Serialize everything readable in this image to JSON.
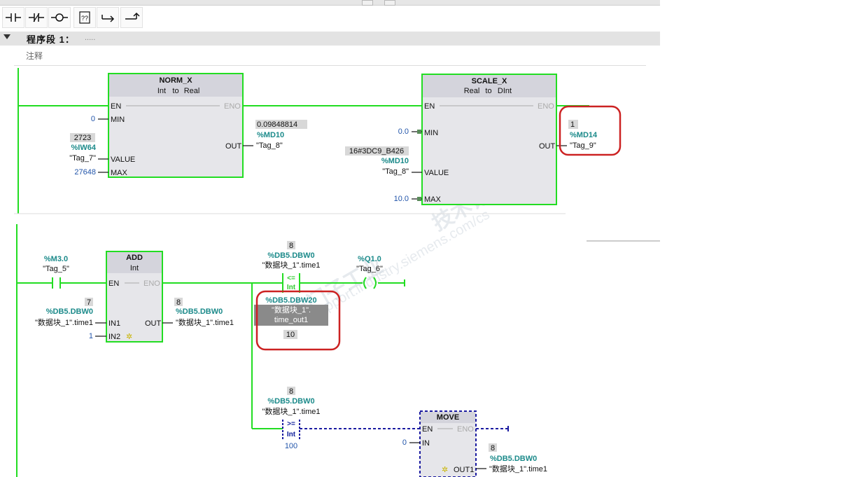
{
  "toolbar": {
    "buttons": [
      {
        "name": "no-contact-icon"
      },
      {
        "name": "nc-contact-icon"
      },
      {
        "name": "coil-icon"
      },
      {
        "name": "empty-box-icon"
      },
      {
        "name": "open-branch-icon"
      },
      {
        "name": "close-branch-icon"
      }
    ]
  },
  "segment": {
    "title": "程序段 1：",
    "dots": ".....",
    "comment": "注释"
  },
  "colors": {
    "power": "#22dd22",
    "blue_wire": "#1a1aa0",
    "highlight": "#cc2222",
    "tag": "#1b8a8a",
    "block_fill": "#e6e6ea"
  },
  "norm": {
    "name": "NORM_X",
    "type1": "Int",
    "to": "to",
    "type2": "Real",
    "en": "EN",
    "eno": "ENO",
    "min": "MIN",
    "value": "VALUE",
    "max": "MAX",
    "out": "OUT",
    "min_val": "0",
    "value_live": "2723",
    "value_addr": "%IW64",
    "value_tag": "\"Tag_7\"",
    "max_val": "27648",
    "out_live": "0.09848814",
    "out_addr": "%MD10",
    "out_tag": "\"Tag_8\""
  },
  "scale": {
    "name": "SCALE_X",
    "type1": "Real",
    "to": "to",
    "type2": "DInt",
    "en": "EN",
    "eno": "ENO",
    "min": "MIN",
    "value": "VALUE",
    "max": "MAX",
    "out": "OUT",
    "min_val": "0.0",
    "value_live": "16#3DC9_B426",
    "value_addr": "%MD10",
    "value_tag": "\"Tag_8\"",
    "max_val": "10.0",
    "out_live": "1",
    "out_addr": "%MD14",
    "out_tag": "\"Tag_9\""
  },
  "rung2": {
    "m30_addr": "%M3.0",
    "m30_tag": "\"Tag_5\"",
    "add": {
      "name": "ADD",
      "type": "Int",
      "en": "EN",
      "eno": "ENO",
      "in1": "IN1",
      "in2": "IN2",
      "out": "OUT",
      "in1_live": "7",
      "in1_addr": "%DB5.DBW0",
      "in1_tag": "\"数据块_1\".time1",
      "in2_val": "1",
      "out_live": "8",
      "out_addr": "%DB5.DBW0",
      "out_tag": "\"数据块_1\".time1"
    },
    "cmp_le": {
      "op": "<=",
      "type": "Int",
      "top_live": "8",
      "top_addr": "%DB5.DBW0",
      "top_tag": "\"数据块_1\".time1",
      "bot_addr": "%DB5.DBW20",
      "bot_tag1": "\"数据块_1\".",
      "bot_tag2": "time_out1",
      "bot_live": "10"
    },
    "coil": {
      "addr": "%Q1.0",
      "tag": "\"Tag_6\""
    },
    "cmp_ge": {
      "op": ">=",
      "type": "Int",
      "top_live": "8",
      "top_addr": "%DB5.DBW0",
      "top_tag": "\"数据块_1\".time1",
      "bot_val": "100"
    },
    "move": {
      "name": "MOVE",
      "en": "EN",
      "eno": "ENO",
      "in": "IN",
      "out1": "OUT1",
      "in_val": "0",
      "out_live": "8",
      "out_addr": "%DB5.DBW0",
      "out_tag": "\"数据块_1\".time1"
    }
  },
  "watermark": {
    "text1": "西门子工业",
    "text2": "技术论坛",
    "text3": "support.industry.siemens.com/cs"
  }
}
